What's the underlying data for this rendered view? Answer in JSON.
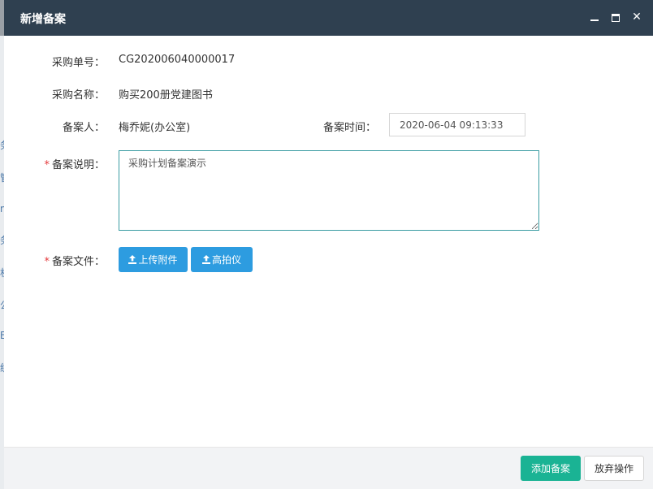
{
  "background": {
    "fragments": [
      "务",
      "管",
      "m",
      "务",
      "机",
      "公",
      "E",
      "统"
    ]
  },
  "dialog": {
    "title": "新增备案",
    "controls": {
      "close_symbol": "✕"
    }
  },
  "form": {
    "purchase_no_label": "采购单号：",
    "purchase_no_value": "CG202006040000017",
    "purchase_name_label": "采购名称：",
    "purchase_name_value": "购买200册党建图书",
    "filer_label": "备案人：",
    "filer_value": "梅乔妮(办公室)",
    "filing_time_label": "备案时间：",
    "filing_time_value": "2020-06-04 09:13:33",
    "required_mark": "*",
    "desc_label": "备案说明：",
    "desc_value": "采购计划备案演示",
    "file_label": "备案文件：",
    "upload_button": "上传附件",
    "scanner_button": "高拍仪"
  },
  "footer": {
    "add_button": "添加备案",
    "cancel_button": "放弃操作"
  },
  "colors": {
    "titlebar": "#2f4050",
    "primary_blue": "#2d9ce0",
    "primary_green": "#1ab394",
    "required": "#e4393c"
  }
}
